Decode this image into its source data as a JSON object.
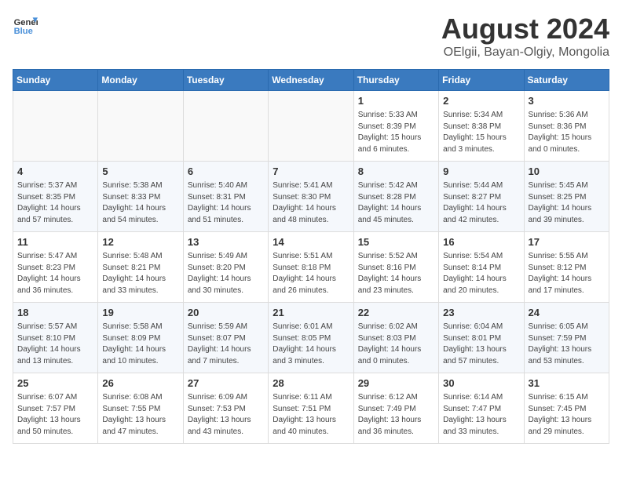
{
  "logo": {
    "line1": "General",
    "line2": "Blue"
  },
  "title": "August 2024",
  "subtitle": "OElgii, Bayan-Olgiy, Mongolia",
  "weekdays": [
    "Sunday",
    "Monday",
    "Tuesday",
    "Wednesday",
    "Thursday",
    "Friday",
    "Saturday"
  ],
  "weeks": [
    [
      {
        "day": "",
        "info": ""
      },
      {
        "day": "",
        "info": ""
      },
      {
        "day": "",
        "info": ""
      },
      {
        "day": "",
        "info": ""
      },
      {
        "day": "1",
        "info": "Sunrise: 5:33 AM\nSunset: 8:39 PM\nDaylight: 15 hours\nand 6 minutes."
      },
      {
        "day": "2",
        "info": "Sunrise: 5:34 AM\nSunset: 8:38 PM\nDaylight: 15 hours\nand 3 minutes."
      },
      {
        "day": "3",
        "info": "Sunrise: 5:36 AM\nSunset: 8:36 PM\nDaylight: 15 hours\nand 0 minutes."
      }
    ],
    [
      {
        "day": "4",
        "info": "Sunrise: 5:37 AM\nSunset: 8:35 PM\nDaylight: 14 hours\nand 57 minutes."
      },
      {
        "day": "5",
        "info": "Sunrise: 5:38 AM\nSunset: 8:33 PM\nDaylight: 14 hours\nand 54 minutes."
      },
      {
        "day": "6",
        "info": "Sunrise: 5:40 AM\nSunset: 8:31 PM\nDaylight: 14 hours\nand 51 minutes."
      },
      {
        "day": "7",
        "info": "Sunrise: 5:41 AM\nSunset: 8:30 PM\nDaylight: 14 hours\nand 48 minutes."
      },
      {
        "day": "8",
        "info": "Sunrise: 5:42 AM\nSunset: 8:28 PM\nDaylight: 14 hours\nand 45 minutes."
      },
      {
        "day": "9",
        "info": "Sunrise: 5:44 AM\nSunset: 8:27 PM\nDaylight: 14 hours\nand 42 minutes."
      },
      {
        "day": "10",
        "info": "Sunrise: 5:45 AM\nSunset: 8:25 PM\nDaylight: 14 hours\nand 39 minutes."
      }
    ],
    [
      {
        "day": "11",
        "info": "Sunrise: 5:47 AM\nSunset: 8:23 PM\nDaylight: 14 hours\nand 36 minutes."
      },
      {
        "day": "12",
        "info": "Sunrise: 5:48 AM\nSunset: 8:21 PM\nDaylight: 14 hours\nand 33 minutes."
      },
      {
        "day": "13",
        "info": "Sunrise: 5:49 AM\nSunset: 8:20 PM\nDaylight: 14 hours\nand 30 minutes."
      },
      {
        "day": "14",
        "info": "Sunrise: 5:51 AM\nSunset: 8:18 PM\nDaylight: 14 hours\nand 26 minutes."
      },
      {
        "day": "15",
        "info": "Sunrise: 5:52 AM\nSunset: 8:16 PM\nDaylight: 14 hours\nand 23 minutes."
      },
      {
        "day": "16",
        "info": "Sunrise: 5:54 AM\nSunset: 8:14 PM\nDaylight: 14 hours\nand 20 minutes."
      },
      {
        "day": "17",
        "info": "Sunrise: 5:55 AM\nSunset: 8:12 PM\nDaylight: 14 hours\nand 17 minutes."
      }
    ],
    [
      {
        "day": "18",
        "info": "Sunrise: 5:57 AM\nSunset: 8:10 PM\nDaylight: 14 hours\nand 13 minutes."
      },
      {
        "day": "19",
        "info": "Sunrise: 5:58 AM\nSunset: 8:09 PM\nDaylight: 14 hours\nand 10 minutes."
      },
      {
        "day": "20",
        "info": "Sunrise: 5:59 AM\nSunset: 8:07 PM\nDaylight: 14 hours\nand 7 minutes."
      },
      {
        "day": "21",
        "info": "Sunrise: 6:01 AM\nSunset: 8:05 PM\nDaylight: 14 hours\nand 3 minutes."
      },
      {
        "day": "22",
        "info": "Sunrise: 6:02 AM\nSunset: 8:03 PM\nDaylight: 14 hours\nand 0 minutes."
      },
      {
        "day": "23",
        "info": "Sunrise: 6:04 AM\nSunset: 8:01 PM\nDaylight: 13 hours\nand 57 minutes."
      },
      {
        "day": "24",
        "info": "Sunrise: 6:05 AM\nSunset: 7:59 PM\nDaylight: 13 hours\nand 53 minutes."
      }
    ],
    [
      {
        "day": "25",
        "info": "Sunrise: 6:07 AM\nSunset: 7:57 PM\nDaylight: 13 hours\nand 50 minutes."
      },
      {
        "day": "26",
        "info": "Sunrise: 6:08 AM\nSunset: 7:55 PM\nDaylight: 13 hours\nand 47 minutes."
      },
      {
        "day": "27",
        "info": "Sunrise: 6:09 AM\nSunset: 7:53 PM\nDaylight: 13 hours\nand 43 minutes."
      },
      {
        "day": "28",
        "info": "Sunrise: 6:11 AM\nSunset: 7:51 PM\nDaylight: 13 hours\nand 40 minutes."
      },
      {
        "day": "29",
        "info": "Sunrise: 6:12 AM\nSunset: 7:49 PM\nDaylight: 13 hours\nand 36 minutes."
      },
      {
        "day": "30",
        "info": "Sunrise: 6:14 AM\nSunset: 7:47 PM\nDaylight: 13 hours\nand 33 minutes."
      },
      {
        "day": "31",
        "info": "Sunrise: 6:15 AM\nSunset: 7:45 PM\nDaylight: 13 hours\nand 29 minutes."
      }
    ]
  ]
}
